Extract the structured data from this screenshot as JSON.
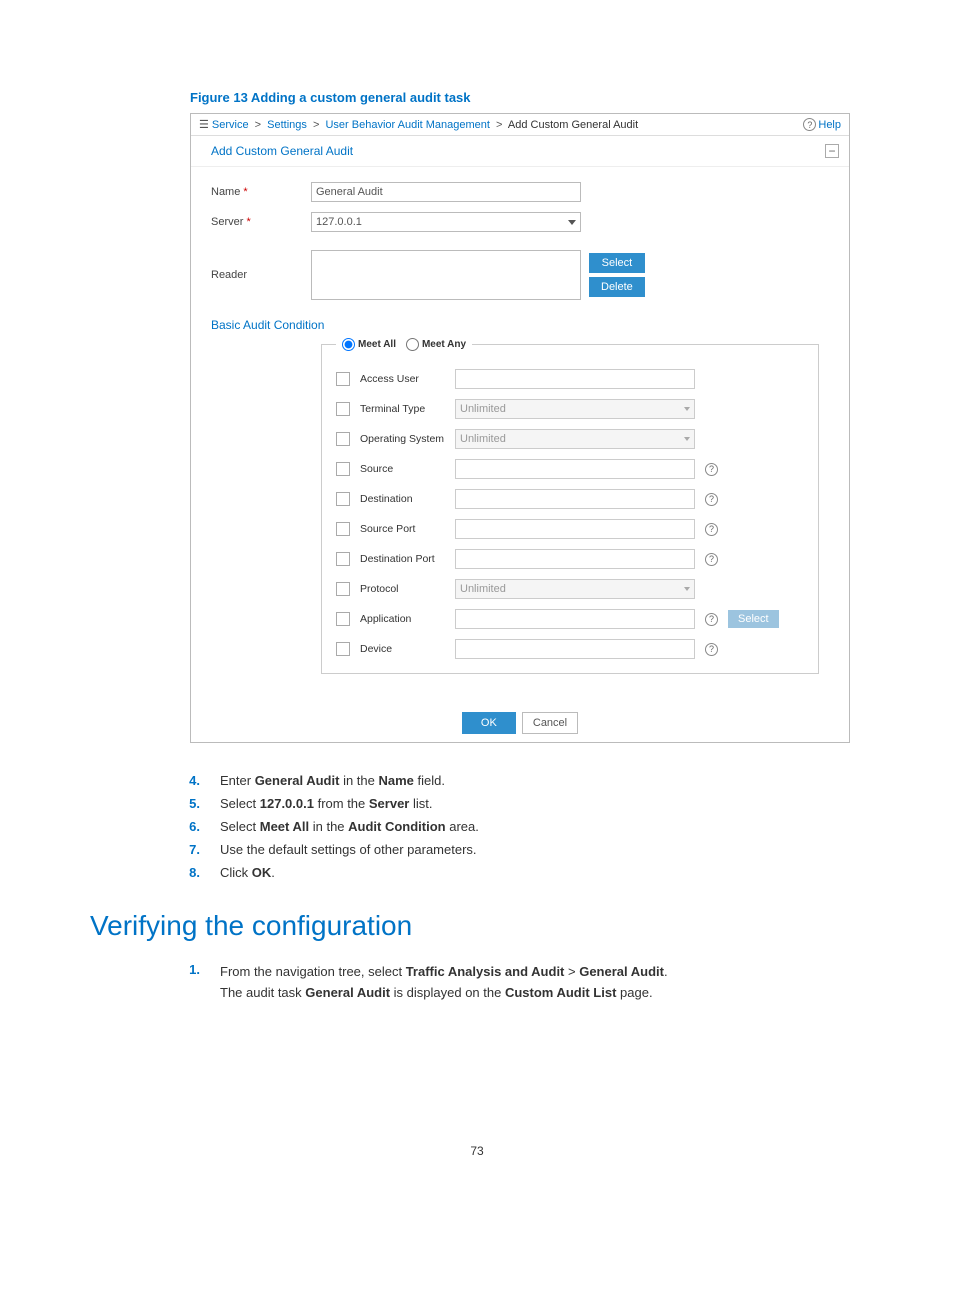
{
  "figure_caption": "Figure 13 Adding a custom general audit task",
  "breadcrumb": {
    "items": [
      "Service",
      "Settings",
      "User Behavior Audit Management",
      "Add Custom General Audit"
    ]
  },
  "header": {
    "help_label": "Help",
    "panel_title": "Add Custom General Audit"
  },
  "form": {
    "name_label": "Name",
    "name_value": "General Audit",
    "server_label": "Server",
    "server_value": "127.0.0.1",
    "reader_label": "Reader",
    "select_btn": "Select",
    "delete_btn": "Delete"
  },
  "basic_cond_header": "Basic Audit Condition",
  "cond": {
    "meet_all": "Meet All",
    "meet_any": "Meet Any",
    "rows": [
      {
        "label": "Access User",
        "type": "text"
      },
      {
        "label": "Terminal Type",
        "type": "select",
        "placeholder": "Unlimited",
        "disabled": true
      },
      {
        "label": "Operating System",
        "type": "select",
        "placeholder": "Unlimited",
        "disabled": true
      },
      {
        "label": "Source",
        "type": "text",
        "help": true
      },
      {
        "label": "Destination",
        "type": "text",
        "help": true
      },
      {
        "label": "Source Port",
        "type": "text",
        "help": true
      },
      {
        "label": "Destination Port",
        "type": "text",
        "help": true
      },
      {
        "label": "Protocol",
        "type": "select",
        "placeholder": "Unlimited",
        "disabled": true
      },
      {
        "label": "Application",
        "type": "text",
        "help": true,
        "select_btn": "Select"
      },
      {
        "label": "Device",
        "type": "text",
        "help": true
      }
    ]
  },
  "buttons": {
    "ok": "OK",
    "cancel": "Cancel"
  },
  "steps": [
    {
      "num": "4.",
      "html": "Enter <b>General Audit</b> in the <b>Name</b> field."
    },
    {
      "num": "5.",
      "html": "Select <b>127.0.0.1</b> from the <b>Server</b> list."
    },
    {
      "num": "6.",
      "html": "Select <b>Meet All</b> in the <b>Audit Condition</b> area."
    },
    {
      "num": "7.",
      "html": "Use the default settings of other parameters."
    },
    {
      "num": "8.",
      "html": "Click <b>OK</b>."
    }
  ],
  "h2": "Verifying the configuration",
  "verify_steps": [
    {
      "num": "1.",
      "lines": [
        "From the navigation tree, select <b>Traffic Analysis and Audit</b> > <b>General Audit</b>.",
        "The audit task <b>General Audit</b> is displayed on the <b>Custom Audit List</b> page."
      ]
    }
  ],
  "page_number": "73"
}
